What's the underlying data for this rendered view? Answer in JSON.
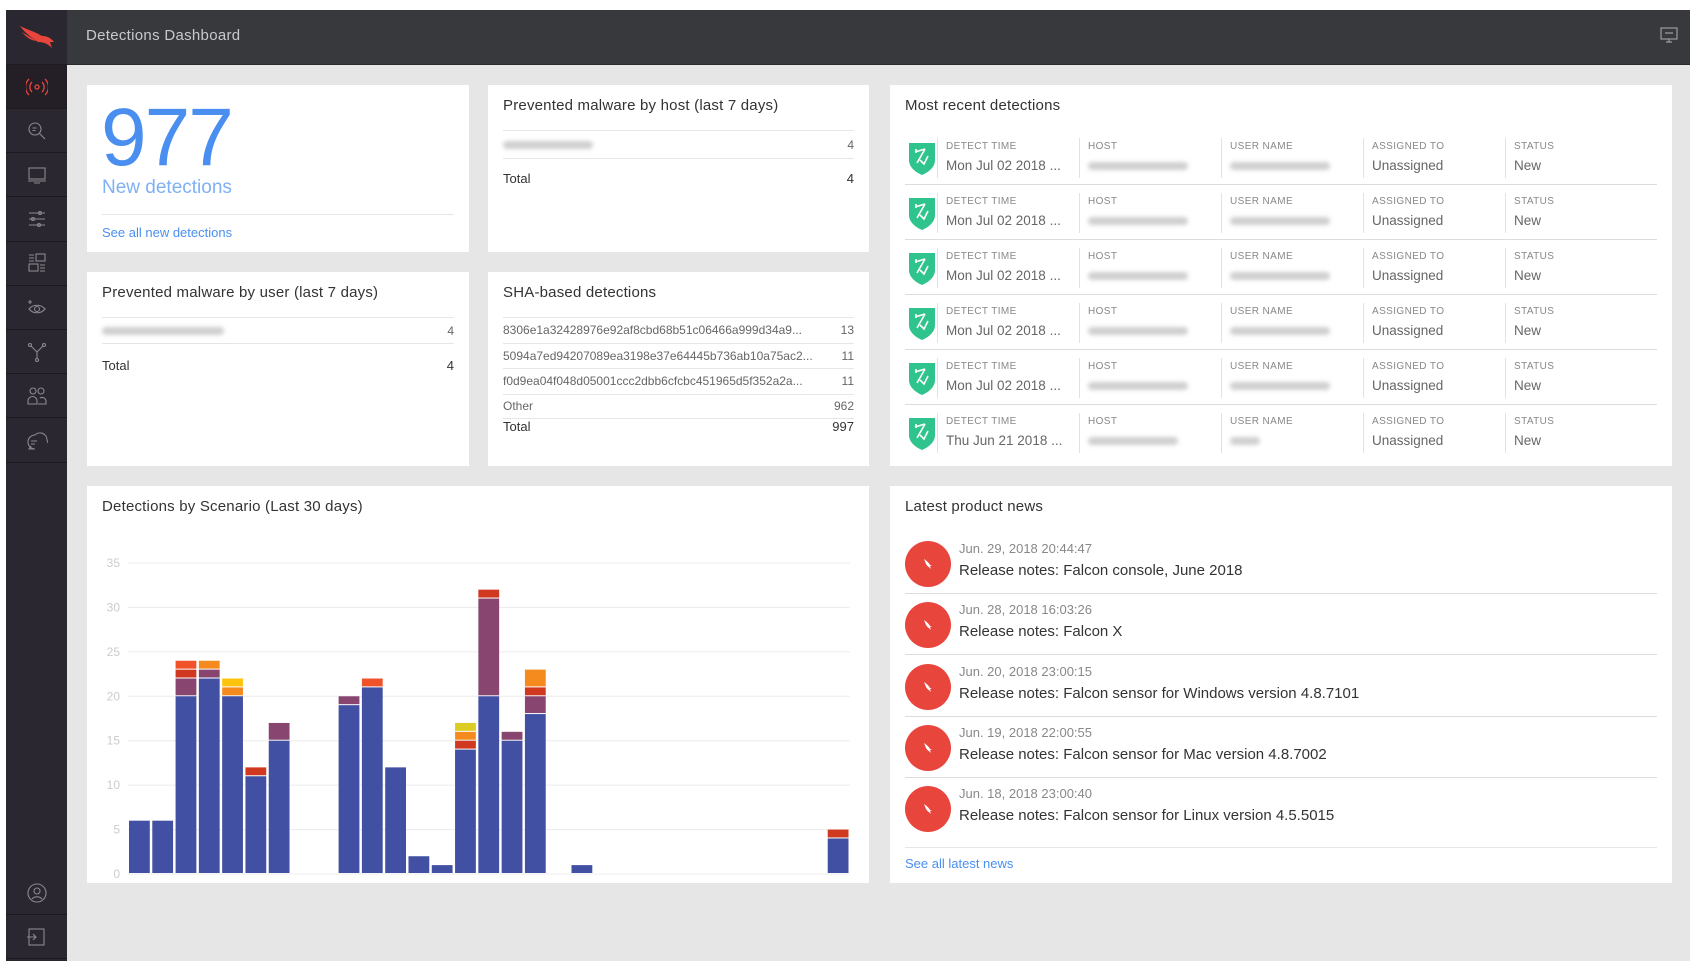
{
  "header": {
    "title": "Detections Dashboard",
    "screen_icon": "monitor-icon"
  },
  "sidebar": {
    "items": [
      {
        "name": "activity",
        "icon": "broadcast-icon",
        "active": true
      },
      {
        "name": "investigate",
        "icon": "search-icon"
      },
      {
        "name": "hosts",
        "icon": "computer-icon"
      },
      {
        "name": "configuration",
        "icon": "sliders-icon"
      },
      {
        "name": "dashboards",
        "icon": "dashboard-icon"
      },
      {
        "name": "discover",
        "icon": "eye-icon"
      },
      {
        "name": "apps",
        "icon": "branch-icon"
      },
      {
        "name": "users",
        "icon": "users-icon"
      },
      {
        "name": "support",
        "icon": "chat-icon"
      }
    ],
    "bottom": [
      {
        "name": "account",
        "icon": "user-icon"
      },
      {
        "name": "logout",
        "icon": "logout-icon"
      }
    ]
  },
  "new_detections": {
    "count": "977",
    "label": "New detections",
    "link": "See all new detections"
  },
  "by_host": {
    "title": "Prevented malware by host (last 7 days)",
    "rows": [
      {
        "count": "4"
      }
    ],
    "total_label": "Total",
    "total": "4"
  },
  "by_user": {
    "title": "Prevented malware by user (last 7 days)",
    "rows": [
      {
        "count": "4"
      }
    ],
    "total_label": "Total",
    "total": "4"
  },
  "sha": {
    "title": "SHA-based detections",
    "rows": [
      {
        "hash": "8306e1a32428976e92af8cbd68b51c06466a999d34a9...",
        "count": "13"
      },
      {
        "hash": "5094a7ed94207089ea3198e37e64445b736ab10a75ac2...",
        "count": "11"
      },
      {
        "hash": "f0d9ea04f048d05001ccc2dbb6cfcbc451965d5f352a2a...",
        "count": "11"
      },
      {
        "hash": "Other",
        "count": "962"
      }
    ],
    "total_label": "Total",
    "total": "997"
  },
  "recent": {
    "title": "Most recent detections",
    "columns": [
      "DETECT TIME",
      "HOST",
      "USER NAME",
      "ASSIGNED TO",
      "STATUS"
    ],
    "rows": [
      {
        "time": "Mon Jul 02 2018 ...",
        "assigned": "Unassigned",
        "status": "New"
      },
      {
        "time": "Mon Jul 02 2018 ...",
        "assigned": "Unassigned",
        "status": "New"
      },
      {
        "time": "Mon Jul 02 2018 ...",
        "assigned": "Unassigned",
        "status": "New"
      },
      {
        "time": "Mon Jul 02 2018 ...",
        "assigned": "Unassigned",
        "status": "New"
      },
      {
        "time": "Mon Jul 02 2018 ...",
        "assigned": "Unassigned",
        "status": "New"
      },
      {
        "time": "Thu Jun 21 2018 ...",
        "assigned": "Unassigned",
        "status": "New"
      }
    ],
    "shield_color": "#2fc48d"
  },
  "news": {
    "title": "Latest product news",
    "items": [
      {
        "date": "Jun. 29, 2018 20:44:47",
        "title": "Release notes: Falcon console, June 2018"
      },
      {
        "date": "Jun. 28, 2018 16:03:26",
        "title": "Release notes: Falcon X"
      },
      {
        "date": "Jun. 20, 2018 23:00:15",
        "title": "Release notes: Falcon sensor for Windows version 4.8.7101"
      },
      {
        "date": "Jun. 19, 2018 22:00:55",
        "title": "Release notes: Falcon sensor for Mac version 4.8.7002"
      },
      {
        "date": "Jun. 18, 2018 23:00:40",
        "title": "Release notes: Falcon sensor for Linux version 4.5.5015"
      }
    ],
    "link": "See all latest news",
    "icon_color": "#e8453c"
  },
  "chart_title": "Detections by Scenario (Last 30 days)",
  "chart_data": {
    "type": "bar",
    "stacked": true,
    "title": "Detections by Scenario (Last 30 days)",
    "ylim": [
      0,
      35
    ],
    "yticks": [
      0,
      5,
      10,
      15,
      20,
      25,
      30,
      35
    ],
    "grid": true,
    "series": [
      {
        "color": "#4150a3",
        "values": [
          6,
          6,
          20,
          22,
          20,
          11,
          15,
          0,
          0,
          19,
          21,
          12,
          2,
          1,
          14,
          20,
          15,
          18,
          0,
          1,
          0,
          0,
          0,
          0,
          0,
          0,
          0,
          0,
          0,
          0,
          4
        ]
      },
      {
        "color": "#87456f",
        "values": [
          0,
          0,
          2,
          1,
          0,
          0,
          2,
          0,
          0,
          1,
          0,
          0,
          0,
          0,
          0,
          11,
          1,
          2,
          0,
          0,
          0,
          0,
          0,
          0,
          0,
          0,
          0,
          0,
          0,
          0,
          0
        ]
      },
      {
        "color": "#d0391f",
        "values": [
          0,
          0,
          1,
          0,
          0,
          1,
          0,
          0,
          0,
          0,
          0,
          0,
          0,
          0,
          1,
          1,
          0,
          1,
          0,
          0,
          0,
          0,
          0,
          0,
          0,
          0,
          0,
          0,
          0,
          0,
          1
        ]
      },
      {
        "color": "#f0522a",
        "values": [
          0,
          0,
          1,
          0,
          0,
          0,
          0,
          0,
          0,
          0,
          1,
          0,
          0,
          0,
          0,
          0,
          0,
          0,
          0,
          0,
          0,
          0,
          0,
          0,
          0,
          0,
          0,
          0,
          0,
          0,
          0
        ]
      },
      {
        "color": "#f58b1f",
        "values": [
          0,
          0,
          0,
          1,
          1,
          0,
          0,
          0,
          0,
          0,
          0,
          0,
          0,
          0,
          1,
          0,
          0,
          2,
          0,
          0,
          0,
          0,
          0,
          0,
          0,
          0,
          0,
          0,
          0,
          0,
          0
        ]
      },
      {
        "color": "#fdc30f",
        "values": [
          0,
          0,
          0,
          0,
          1,
          0,
          0,
          0,
          0,
          0,
          0,
          0,
          0,
          0,
          0,
          0,
          0,
          0,
          0,
          0,
          0,
          0,
          0,
          0,
          0,
          0,
          0,
          0,
          0,
          0,
          0
        ]
      },
      {
        "color": "#dccd22",
        "values": [
          0,
          0,
          0,
          0,
          0,
          0,
          0,
          0,
          0,
          0,
          0,
          0,
          0,
          0,
          1,
          0,
          0,
          0,
          0,
          0,
          0,
          0,
          0,
          0,
          0,
          0,
          0,
          0,
          0,
          0,
          0
        ]
      }
    ]
  }
}
